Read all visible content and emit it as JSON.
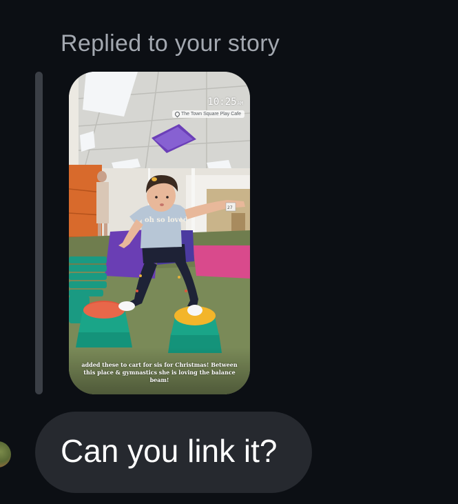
{
  "reply": {
    "label": "Replied to your story"
  },
  "story": {
    "time": "10:25",
    "time_suffix": "AM",
    "location": "The Town Square Play Cafe",
    "shirt_text": "oh so loved",
    "wall_sign": "27",
    "caption": "added these to cart for sis for Christmas! Between this place & gymnastics she is loving the balance beam!"
  },
  "message": {
    "text": "Can you link it?"
  },
  "colors": {
    "background": "#0c0f14",
    "bubble": "#26292f",
    "label": "#a3a8b0",
    "quote_bar": "#3b3f46"
  }
}
